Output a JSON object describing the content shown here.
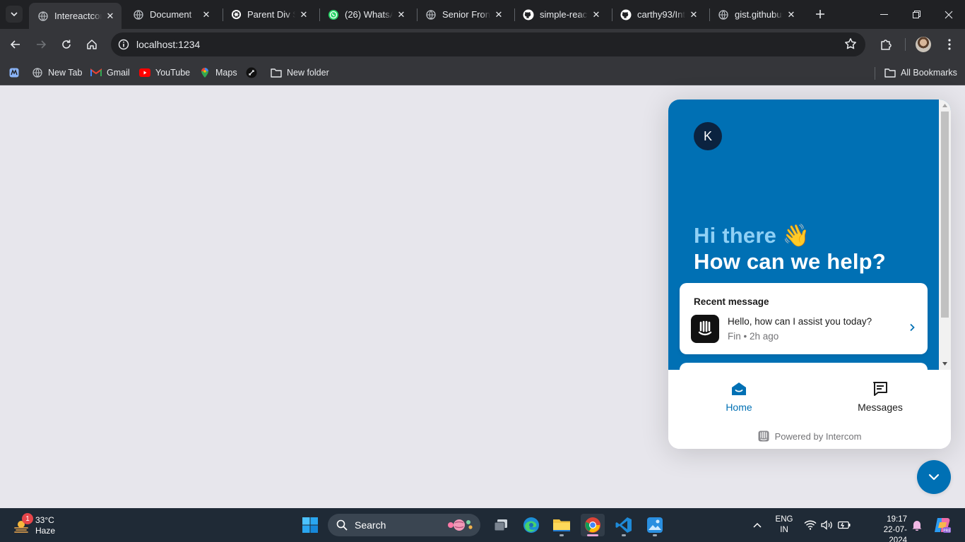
{
  "browser": {
    "tabs": [
      {
        "title": "Intereactcom",
        "active": true,
        "icon": "globe-icon"
      },
      {
        "title": "Document",
        "active": false,
        "icon": "globe-icon"
      },
      {
        "title": "Parent Div Sc",
        "active": false,
        "icon": "chatgpt-icon"
      },
      {
        "title": "(26) WhatsAp",
        "active": false,
        "icon": "whatsapp-icon"
      },
      {
        "title": "Senior Fronte",
        "active": false,
        "icon": "globe-icon"
      },
      {
        "title": "simple-react",
        "active": false,
        "icon": "github-icon"
      },
      {
        "title": "carthy93/Inte",
        "active": false,
        "icon": "github-icon"
      },
      {
        "title": "gist.githubus",
        "active": false,
        "icon": "globe-icon"
      }
    ],
    "address": "localhost:1234",
    "bookmarks": [
      {
        "label": "",
        "icon": "app-icon"
      },
      {
        "label": "New Tab",
        "icon": "globe-icon"
      },
      {
        "label": "Gmail",
        "icon": "gmail-icon"
      },
      {
        "label": "YouTube",
        "icon": "youtube-icon"
      },
      {
        "label": "Maps",
        "icon": "maps-icon"
      },
      {
        "label": "",
        "icon": "extension-bookmark-icon"
      },
      {
        "label": "New folder",
        "icon": "folder-icon"
      }
    ],
    "all_bookmarks": "All Bookmarks"
  },
  "messenger": {
    "logo_letter": "K",
    "greeting_line1": "Hi there 👋",
    "greeting_line2": "How can we help?",
    "recent": {
      "title": "Recent message",
      "message": "Hello, how can I assist you today?",
      "meta": "Fin • 2h ago"
    },
    "nav": {
      "home": "Home",
      "messages": "Messages"
    },
    "powered_by": "Powered by Intercom",
    "accent_color": "#0070b4"
  },
  "taskbar": {
    "weather": {
      "badge": "1",
      "temp": "33°C",
      "condition": "Haze"
    },
    "search_label": "Search",
    "lang_line1": "ENG",
    "lang_line2": "IN",
    "time": "19:17",
    "date": "22-07-2024"
  }
}
